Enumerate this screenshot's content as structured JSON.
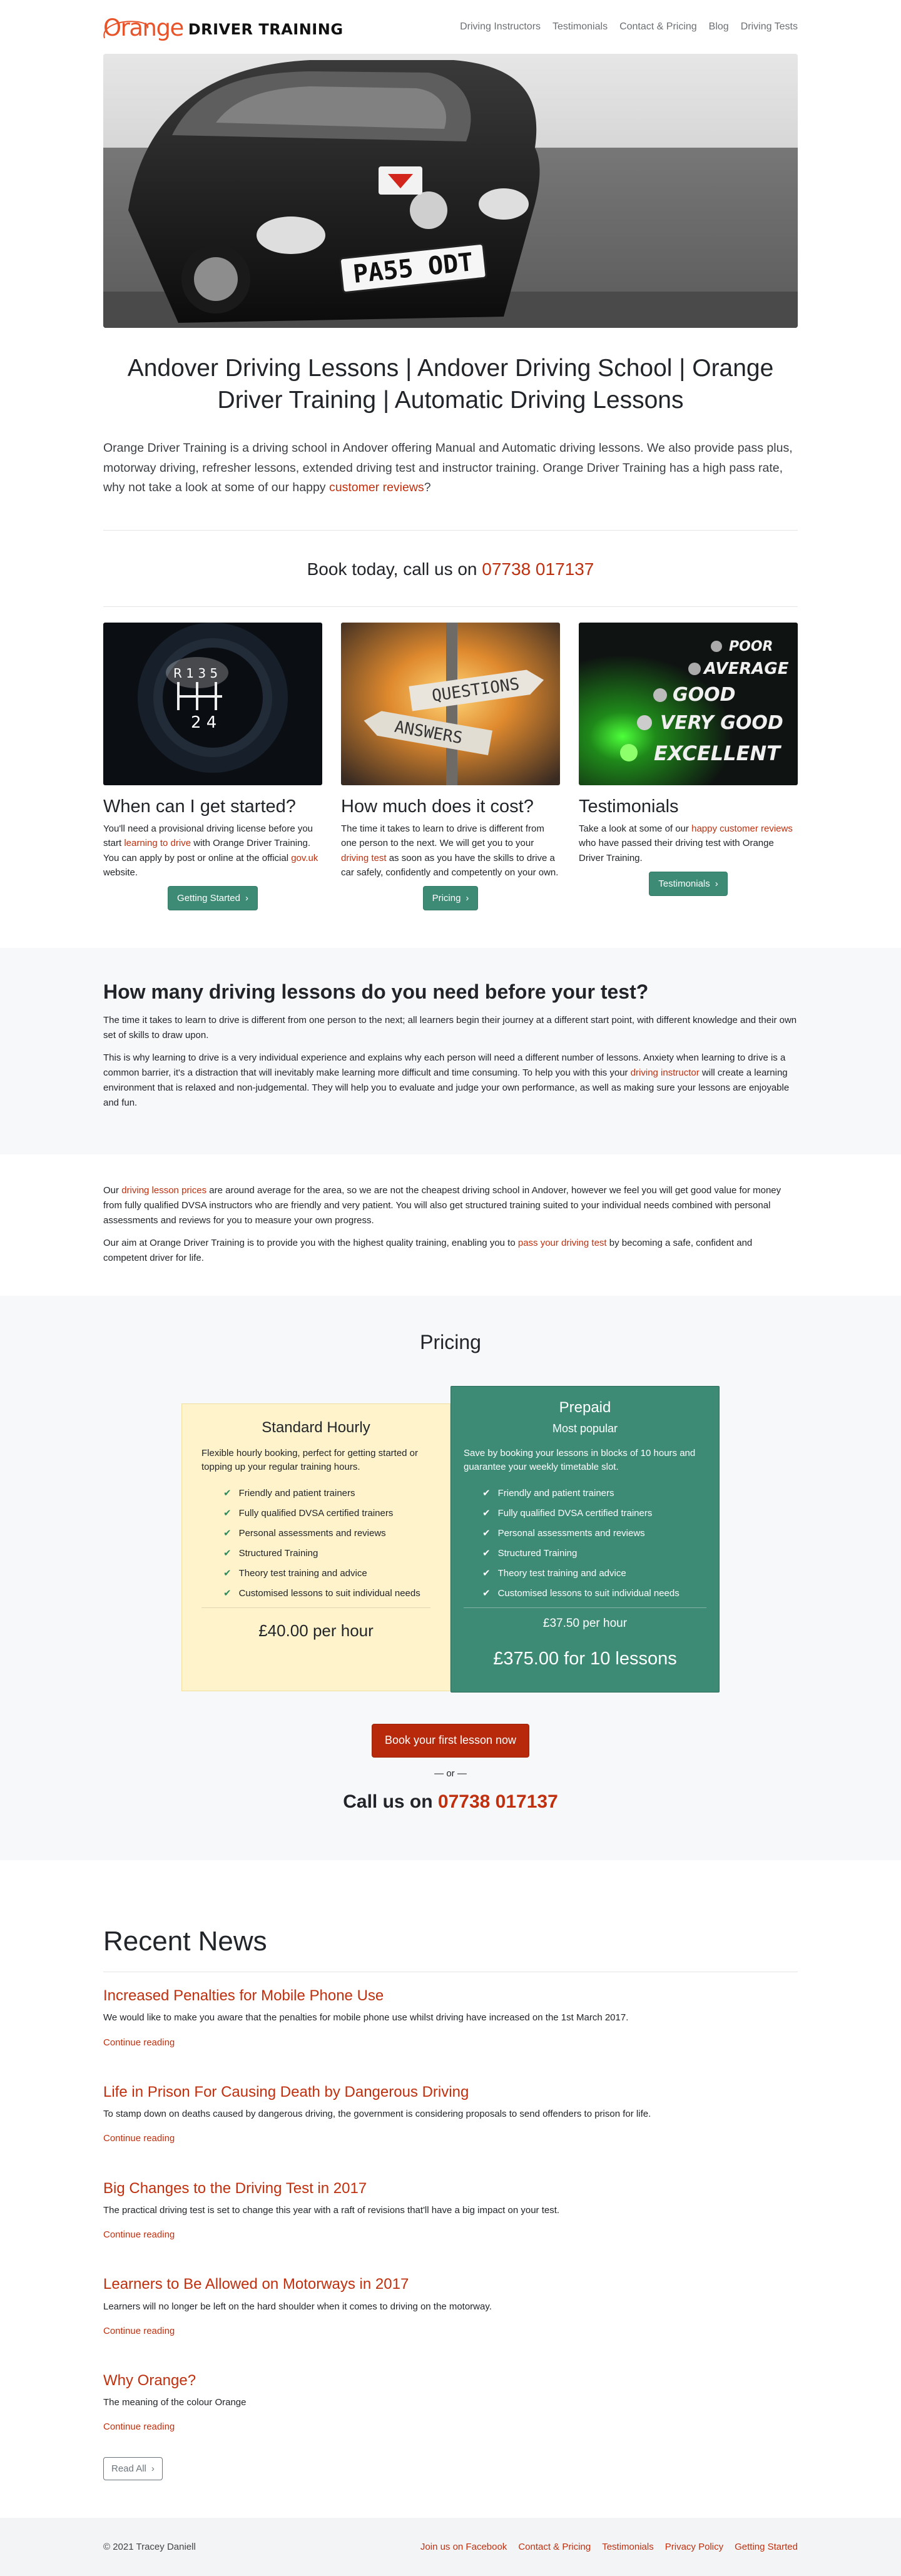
{
  "brand": {
    "orange": "Orange",
    "rest": "DRIVER TRAINING"
  },
  "nav": [
    "Driving Instructors",
    "Testimonials",
    "Contact & Pricing",
    "Blog",
    "Driving Tests"
  ],
  "hero": {
    "plate": "PA55 ODT"
  },
  "title": "Andover Driving Lessons | Andover Driving School | Orange Driver Training | Automatic Driving Lessons",
  "lead": {
    "text": "Orange Driver Training is a driving school in Andover offering Manual and Automatic driving lessons. We also provide pass plus, motorway driving, refresher lessons, extended driving test and instructor training. Orange Driver Training has a high pass rate, why not take a look at some of our happy ",
    "link": "customer reviews",
    "end": "?"
  },
  "book": {
    "text": "Book today, call us on ",
    "phone": "07738 017137"
  },
  "features": [
    {
      "title": "When can I get started?",
      "p1": "You'll need a provisional driving license before you start ",
      "link1": "learning to drive",
      "p2": " with Orange Driver Training. You can apply by post or online at the official ",
      "link2": "gov.uk",
      "p3": " website.",
      "button": "Getting Started"
    },
    {
      "title": "How much does it cost?",
      "p1": "The time it takes to learn to drive is different from one person to the next. We will get you to your ",
      "link1": "driving test",
      "p2": " as soon as you have the skills to drive a car safely, confidently and competently on your own.",
      "button": "Pricing",
      "sign1": "QUESTIONS",
      "sign2": "ANSWERS"
    },
    {
      "title": "Testimonials",
      "p1": "Take a look at some of our ",
      "link1": "happy customer reviews",
      "p2": " who have passed their driving test with Orange Driver Training.",
      "button": "Testimonials",
      "ratings": [
        "POOR",
        "AVERAGE",
        "GOOD",
        "VERY GOOD",
        "EXCELLENT"
      ]
    }
  ],
  "info": {
    "heading": "How many driving lessons do you need before your test?",
    "p1": "The time it takes to learn to drive is different from one person to the next; all learners begin their journey at a different start point, with different knowledge and their own set of skills to draw upon.",
    "p2a": "This is why learning to drive is a very individual experience and explains why each person will need a different number of lessons. Anxiety when learning to drive is a common barrier, it's a distraction that will inevitably make learning more difficult and time consuming. To help you with this your ",
    "p2link": "driving instructor",
    "p2b": " will create a learning environment that is relaxed and non-judgemental. They will help you to evaluate and judge your own performance, as well as making sure your lessons are enjoyable and fun.",
    "p3link": "driving lesson prices",
    "p3": " are around average for the area, so we are not the cheapest driving school in Andover, however we feel you will get good value for money from fully qualified DVSA instructors who are friendly and very patient. You will also get structured training suited to your individual needs combined with personal assessments and reviews for you to measure your own progress.",
    "p3pre": "Our ",
    "p4a": "Our aim at Orange Driver Training is to provide you with the highest quality training, enabling you to ",
    "p4link": "pass your driving test",
    "p4b": " by becoming a safe, confident and competent driver for life."
  },
  "pricing": {
    "heading": "Pricing",
    "standard": {
      "title": "Standard Hourly",
      "desc": "Flexible hourly booking, perfect for getting started or topping up your regular training hours.",
      "items": [
        "Friendly and patient trainers",
        "Fully qualified DVSA certified trainers",
        "Personal assessments and reviews",
        "Structured Training",
        "Theory test training and advice",
        "Customised lessons to suit individual needs"
      ],
      "price": "£40.00 per hour"
    },
    "prepaid": {
      "title": "Prepaid",
      "sub": "Most popular",
      "desc": "Save by booking your lessons in blocks of 10 hours and guarantee your weekly timetable slot.",
      "items": [
        "Friendly and patient trainers",
        "Fully qualified DVSA certified trainers",
        "Personal assessments and reviews",
        "Structured Training",
        "Theory test training and advice",
        "Customised lessons to suit individual needs"
      ],
      "price_hour": "£37.50 per hour",
      "price_block": "£375.00 for 10 lessons"
    },
    "cta": "Book your first lesson now",
    "or": "— or —",
    "call": "Call us on ",
    "phone": "07738 017137"
  },
  "news": {
    "heading": "Recent News",
    "posts": [
      {
        "title": "Increased Penalties for Mobile Phone Use",
        "excerpt": "We would like to make you aware that the penalties for mobile phone use whilst driving have increased on the 1st March 2017.",
        "more": "Continue reading"
      },
      {
        "title": "Life in Prison For Causing Death by Dangerous Driving",
        "excerpt": "To stamp down on deaths caused by dangerous driving, the government is considering proposals to send offenders to prison for life.",
        "more": "Continue reading"
      },
      {
        "title": "Big Changes to the Driving Test in 2017",
        "excerpt": "The practical driving test is set to change this year with a raft of revisions that'll have a big impact on your test.",
        "more": "Continue reading"
      },
      {
        "title": "Learners to Be Allowed on Motorways in 2017",
        "excerpt": "Learners will no longer be left on the hard shoulder when it comes to driving on the motorway.",
        "more": "Continue reading"
      },
      {
        "title": "Why Orange?",
        "excerpt": "The meaning of the colour Orange",
        "more": "Continue reading"
      }
    ],
    "read_all": "Read All"
  },
  "footer": {
    "copy": "© 2021  Tracey Daniell",
    "links": [
      "Join us on Facebook",
      "Contact & Pricing",
      "Testimonials",
      "Privacy Policy",
      "Getting Started"
    ]
  },
  "colors": {
    "accent": "#c0300f",
    "green": "#3d8b74",
    "brand_orange": "#e8542a",
    "cream": "#fff3cb"
  }
}
